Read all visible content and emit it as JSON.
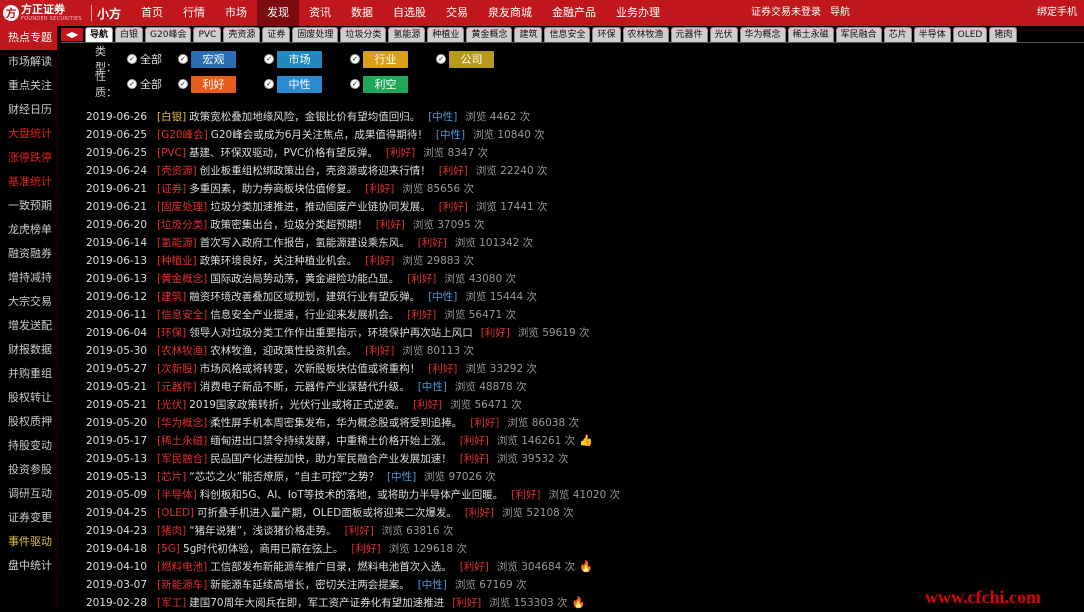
{
  "topbar": {
    "logo_name": "方正证券",
    "logo_sub": "FOUNDER SECURITIES",
    "app_name": "小方",
    "menu": [
      "首页",
      "行情",
      "市场",
      "发现",
      "资讯",
      "数据",
      "自选股",
      "交易",
      "泉友商城",
      "金融产品",
      "业务办理"
    ],
    "active_menu": 3,
    "trade_status": "证券交易未登录",
    "nav": "导航",
    "bind_phone": "绑定手机"
  },
  "sidebar": {
    "items": [
      {
        "label": "热点专题",
        "style": "active"
      },
      {
        "label": "市场解读",
        "style": "normal"
      },
      {
        "label": "重点关注",
        "style": "normal"
      },
      {
        "label": "财经日历",
        "style": "normal"
      },
      {
        "label": "大盘统计",
        "style": "red"
      },
      {
        "label": "涨停跌停",
        "style": "red"
      },
      {
        "label": "基准统计",
        "style": "red"
      },
      {
        "label": "一致预期",
        "style": "normal"
      },
      {
        "label": "龙虎榜单",
        "style": "normal"
      },
      {
        "label": "融资融券",
        "style": "normal"
      },
      {
        "label": "增持减持",
        "style": "normal"
      },
      {
        "label": "大宗交易",
        "style": "normal"
      },
      {
        "label": "增发送配",
        "style": "normal"
      },
      {
        "label": "财报数据",
        "style": "normal"
      },
      {
        "label": "并购重组",
        "style": "normal"
      },
      {
        "label": "股权转让",
        "style": "normal"
      },
      {
        "label": "股权质押",
        "style": "normal"
      },
      {
        "label": "持股变动",
        "style": "normal"
      },
      {
        "label": "投资参股",
        "style": "normal"
      },
      {
        "label": "调研互动",
        "style": "normal"
      },
      {
        "label": "证券变更",
        "style": "normal"
      },
      {
        "label": "事件驱动",
        "style": "gold"
      },
      {
        "label": "盘中统计",
        "style": "normal"
      }
    ]
  },
  "tabs": {
    "arrows": "◀▶",
    "items": [
      "导航",
      "白银",
      "G20峰会",
      "PVC",
      "壳资源",
      "证券",
      "固废处理",
      "垃圾分类",
      "氢能源",
      "种植业",
      "黄金概念",
      "建筑",
      "信息安全",
      "环保",
      "农林牧渔",
      "元器件",
      "光伏",
      "华为概念",
      "稀土永磁",
      "军民融合",
      "芯片",
      "半导体",
      "OLED",
      "猪肉"
    ],
    "active": 0
  },
  "filters": {
    "type_label": "类型：",
    "sentiment_label": "性质：",
    "all_label": "全部",
    "check_mark": "✓",
    "type_tags": [
      {
        "label": "宏观",
        "color": "#2a6db5"
      },
      {
        "label": "市场",
        "color": "#1f8ac0"
      },
      {
        "label": "行业",
        "color": "#d9a017"
      },
      {
        "label": "公司",
        "color": "#b59a1c"
      }
    ],
    "sentiment_tags": [
      {
        "label": "利好",
        "color": "#e65c1a"
      },
      {
        "label": "中性",
        "color": "#2a8bd0"
      },
      {
        "label": "利空",
        "color": "#1fa85a"
      }
    ]
  },
  "news": [
    {
      "date": "2019-06-26",
      "tag": "[白银]",
      "tag_style": "gold",
      "title": "政策宽松叠加地缘风险，金银比价有望均值回归。",
      "sentiment": "[中性]",
      "sentiment_style": "neu",
      "views": "浏览 4462 次",
      "flag": ""
    },
    {
      "date": "2019-06-25",
      "tag": "[G20峰会]",
      "tag_style": "red",
      "title": "G20峰会或成为6月关注焦点，成果值得期待！",
      "sentiment": "[中性]",
      "sentiment_style": "neu",
      "views": "浏览 10840 次",
      "flag": ""
    },
    {
      "date": "2019-06-25",
      "tag": "[PVC]",
      "tag_style": "red",
      "title": "基建、环保双驱动，PVC价格有望反弹。",
      "sentiment": "[利好]",
      "sentiment_style": "bull",
      "views": "浏览 8347 次",
      "flag": ""
    },
    {
      "date": "2019-06-24",
      "tag": "[壳资源]",
      "tag_style": "red",
      "title": "创业板重组松绑政策出台，壳资源或将迎来行情！",
      "sentiment": "[利好]",
      "sentiment_style": "bull",
      "views": "浏览 22240 次",
      "flag": ""
    },
    {
      "date": "2019-06-21",
      "tag": "[证券]",
      "tag_style": "red",
      "title": "多重因素，助力券商板块估值修复。",
      "sentiment": "[利好]",
      "sentiment_style": "bull",
      "views": "浏览 85656 次",
      "flag": ""
    },
    {
      "date": "2019-06-21",
      "tag": "[固废处理]",
      "tag_style": "red",
      "title": "垃圾分类加速推进，推动固废产业链协同发展。",
      "sentiment": "[利好]",
      "sentiment_style": "bull",
      "views": "浏览 17441 次",
      "flag": ""
    },
    {
      "date": "2019-06-20",
      "tag": "[垃圾分类]",
      "tag_style": "red",
      "title": "政策密集出台，垃圾分类超预期！",
      "sentiment": "[利好]",
      "sentiment_style": "bull",
      "views": "浏览 37095 次",
      "flag": ""
    },
    {
      "date": "2019-06-14",
      "tag": "[氢能源]",
      "tag_style": "red",
      "title": "首次写入政府工作报告，氢能源建设乘东风。",
      "sentiment": "[利好]",
      "sentiment_style": "bull",
      "views": "浏览 101342 次",
      "flag": ""
    },
    {
      "date": "2019-06-13",
      "tag": "[种植业]",
      "tag_style": "red",
      "title": "政策环境良好，关注种植业机会。",
      "sentiment": "[利好]",
      "sentiment_style": "bull",
      "views": "浏览 29883 次",
      "flag": ""
    },
    {
      "date": "2019-06-13",
      "tag": "[黄金概念]",
      "tag_style": "red",
      "title": "国际政治局势动荡，黄金避险功能凸显。",
      "sentiment": "[利好]",
      "sentiment_style": "bull",
      "views": "浏览 43080 次",
      "flag": ""
    },
    {
      "date": "2019-06-12",
      "tag": "[建筑]",
      "tag_style": "red",
      "title": "融资环境改善叠加区域规划，建筑行业有望反弹。",
      "sentiment": "[中性]",
      "sentiment_style": "neu",
      "views": "浏览 15444 次",
      "flag": ""
    },
    {
      "date": "2019-06-11",
      "tag": "[信息安全]",
      "tag_style": "red",
      "title": "信息安全产业提速，行业迎来发展机会。",
      "sentiment": "[利好]",
      "sentiment_style": "bull",
      "views": "浏览 56471 次",
      "flag": ""
    },
    {
      "date": "2019-06-04",
      "tag": "[环保]",
      "tag_style": "red",
      "title": "领导人对垃圾分类工作作出重要指示，环境保护再次站上风口",
      "sentiment": "[利好]",
      "sentiment_style": "bull",
      "views": "浏览 59619 次",
      "flag": ""
    },
    {
      "date": "2019-05-30",
      "tag": "[农林牧渔]",
      "tag_style": "red",
      "title": "农林牧渔，迎政策性投资机会。",
      "sentiment": "[利好]",
      "sentiment_style": "bull",
      "views": "浏览 80113 次",
      "flag": ""
    },
    {
      "date": "2019-05-27",
      "tag": "[次新股]",
      "tag_style": "red",
      "title": "市场风格或将转变，次新股板块估值或将重构！",
      "sentiment": "[利好]",
      "sentiment_style": "bull",
      "views": "浏览 33292 次",
      "flag": ""
    },
    {
      "date": "2019-05-21",
      "tag": "[元器件]",
      "tag_style": "red",
      "title": "消费电子新品不断，元器件产业谋替代升级。",
      "sentiment": "[中性]",
      "sentiment_style": "neu",
      "views": "浏览 48878 次",
      "flag": ""
    },
    {
      "date": "2019-05-21",
      "tag": "[光伏]",
      "tag_style": "red",
      "title": "2019国家政策转折，光伏行业或将正式逆袭。",
      "sentiment": "[利好]",
      "sentiment_style": "bull",
      "views": "浏览 56471 次",
      "flag": ""
    },
    {
      "date": "2019-05-20",
      "tag": "[华为概念]",
      "tag_style": "red",
      "title": "柔性屏手机本周密集发布，华为概念股或将受到追捧。",
      "sentiment": "[利好]",
      "sentiment_style": "bull",
      "views": "浏览 86038 次",
      "flag": ""
    },
    {
      "date": "2019-05-17",
      "tag": "[稀土永磁]",
      "tag_style": "red",
      "title": "缅甸进出口禁令持续发酵，中重稀土价格开始上涨。",
      "sentiment": "[利好]",
      "sentiment_style": "bull",
      "views": "浏览 146261 次",
      "flag": "👍"
    },
    {
      "date": "2019-05-13",
      "tag": "[军民融合]",
      "tag_style": "red",
      "title": "民品国产化进程加快，助力军民融合产业发展加速！",
      "sentiment": "[利好]",
      "sentiment_style": "bull",
      "views": "浏览 39532 次",
      "flag": ""
    },
    {
      "date": "2019-05-13",
      "tag": "[芯片]",
      "tag_style": "red",
      "title": "“芯芯之火”能否燎原，“自主可控”之势？",
      "sentiment": "[中性]",
      "sentiment_style": "neu",
      "views": "浏览 97026 次",
      "flag": ""
    },
    {
      "date": "2019-05-09",
      "tag": "[半导体]",
      "tag_style": "red",
      "title": "科创板和5G、AI、IoT等技术的落地，或将助力半导体产业回暖。",
      "sentiment": "[利好]",
      "sentiment_style": "bull",
      "views": "浏览 41020 次",
      "flag": ""
    },
    {
      "date": "2019-04-25",
      "tag": "[OLED]",
      "tag_style": "red",
      "title": "可折叠手机进入量产期，OLED面板或将迎来二次爆发。",
      "sentiment": "[利好]",
      "sentiment_style": "bull",
      "views": "浏览 52108 次",
      "flag": ""
    },
    {
      "date": "2019-04-23",
      "tag": "[猪肉]",
      "tag_style": "red",
      "title": "“猪年说猪”，浅谈猪价格走势。",
      "sentiment": "[利好]",
      "sentiment_style": "bull",
      "views": "浏览 63816 次",
      "flag": ""
    },
    {
      "date": "2019-04-18",
      "tag": "[5G]",
      "tag_style": "red",
      "title": "5g时代初体验，商用已箭在弦上。",
      "sentiment": "[利好]",
      "sentiment_style": "bull",
      "views": "浏览 129618 次",
      "flag": ""
    },
    {
      "date": "2019-04-10",
      "tag": "[燃料电池]",
      "tag_style": "red",
      "title": "工信部发布新能源车推广目录，燃料电池首次入选。",
      "sentiment": "[利好]",
      "sentiment_style": "bull",
      "views": "浏览 304684 次",
      "flag": "🔥"
    },
    {
      "date": "2019-03-07",
      "tag": "[新能源车]",
      "tag_style": "red",
      "title": "新能源车延续高增长，密切关注两会提案。",
      "sentiment": "[中性]",
      "sentiment_style": "neu",
      "views": "浏览 67169 次",
      "flag": ""
    },
    {
      "date": "2019-02-28",
      "tag": "[军工]",
      "tag_style": "red",
      "title": "建国70周年大阅兵在即，军工资产证券化有望加速推进",
      "sentiment": "[利好]",
      "sentiment_style": "bull",
      "views": "浏览 153303 次",
      "flag": "🔥"
    }
  ],
  "watermark": "www.cfchi.com"
}
